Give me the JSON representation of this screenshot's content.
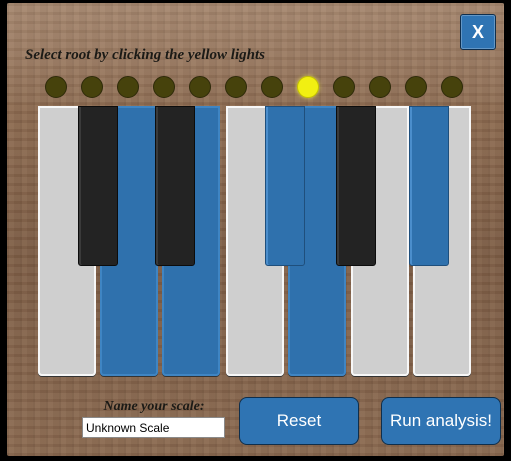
{
  "close": {
    "label": "X"
  },
  "instruction": "Select root by clicking the yellow lights",
  "lights": [
    {
      "note": "C",
      "on": false
    },
    {
      "note": "C#",
      "on": false
    },
    {
      "note": "D",
      "on": false
    },
    {
      "note": "D#",
      "on": false
    },
    {
      "note": "E",
      "on": false
    },
    {
      "note": "F",
      "on": false
    },
    {
      "note": "F#",
      "on": false
    },
    {
      "note": "G",
      "on": true
    },
    {
      "note": "G#",
      "on": false
    },
    {
      "note": "A",
      "on": false
    },
    {
      "note": "A#",
      "on": false
    },
    {
      "note": "B",
      "on": false
    }
  ],
  "keys": {
    "white": [
      {
        "note": "C",
        "selected": false
      },
      {
        "note": "D",
        "selected": true
      },
      {
        "note": "E",
        "selected": true
      },
      {
        "note": "F",
        "selected": false
      },
      {
        "note": "G",
        "selected": true
      },
      {
        "note": "A",
        "selected": false
      },
      {
        "note": "B",
        "selected": false
      }
    ],
    "black": [
      {
        "note": "C#",
        "selected": false
      },
      {
        "note": "D#",
        "selected": false
      },
      {
        "note": "F#",
        "selected": true
      },
      {
        "note": "G#",
        "selected": false
      },
      {
        "note": "A#",
        "selected": true
      }
    ]
  },
  "scale_name": {
    "label": "Name your scale:",
    "value": "Unknown Scale"
  },
  "buttons": {
    "reset": "Reset",
    "run": "Run analysis!"
  },
  "colors": {
    "accent": "#2f74b3",
    "light_on": "#f1ef12",
    "light_off": "#46420c"
  }
}
